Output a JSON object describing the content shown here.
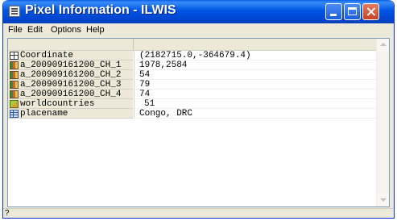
{
  "window": {
    "title": "Pixel Information - ILWIS",
    "icon": "app-window-icon",
    "title_colors": {
      "bar": "#0055e5",
      "close_button": "#c74124"
    }
  },
  "menu": [
    "File",
    "Edit",
    "Options",
    "Help"
  ],
  "grid": {
    "rows": [
      {
        "icon": "coordinate-icon",
        "name": "Coordinate",
        "value": "(2182715.0,-364679.4)",
        "indent": false
      },
      {
        "icon": "raster-map-icon",
        "name": "a_200909161200_CH_1",
        "value": "1978,2584",
        "indent": false
      },
      {
        "icon": "raster-map-icon",
        "name": "a_200909161200_CH_2",
        "value": "54",
        "indent": false
      },
      {
        "icon": "raster-map-icon",
        "name": "a_200909161200_CH_3",
        "value": "79",
        "indent": false
      },
      {
        "icon": "raster-map-icon",
        "name": "a_200909161200_CH_4",
        "value": "74",
        "indent": false
      },
      {
        "icon": "polygon-map-icon",
        "name": "worldcountries",
        "value": "51",
        "indent": true
      },
      {
        "icon": "table-icon",
        "name": "placename",
        "value": "Congo, DRC",
        "indent": false
      }
    ]
  },
  "status": {
    "text": "?"
  }
}
